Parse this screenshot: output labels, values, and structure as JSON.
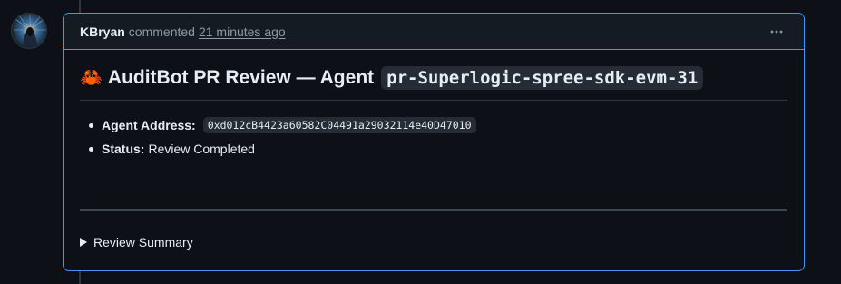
{
  "comment": {
    "author": "KBryan",
    "action": "commented",
    "timestamp": "21 minutes ago",
    "menu_icon": "kebab-horizontal-icon",
    "avatar_icon": "user-avatar"
  },
  "body": {
    "title_emoji": "🦀",
    "title_text": "AuditBot PR Review — Agent",
    "title_code": "pr-Superlogic-spree-sdk-evm-31",
    "items": [
      {
        "label": "Agent Address:",
        "code": "0xd012cB4423a60582C04491a29032114e40D47010"
      },
      {
        "label": "Status:",
        "value": "Review Completed"
      }
    ],
    "details_summary": "Review Summary",
    "reaction_icon": "smiley-icon"
  },
  "colors": {
    "background": "#0d1117",
    "accent_border": "#4493f8",
    "header_bg": "#151b23",
    "muted_text": "#9198a1",
    "code_bg": "#262c36"
  }
}
